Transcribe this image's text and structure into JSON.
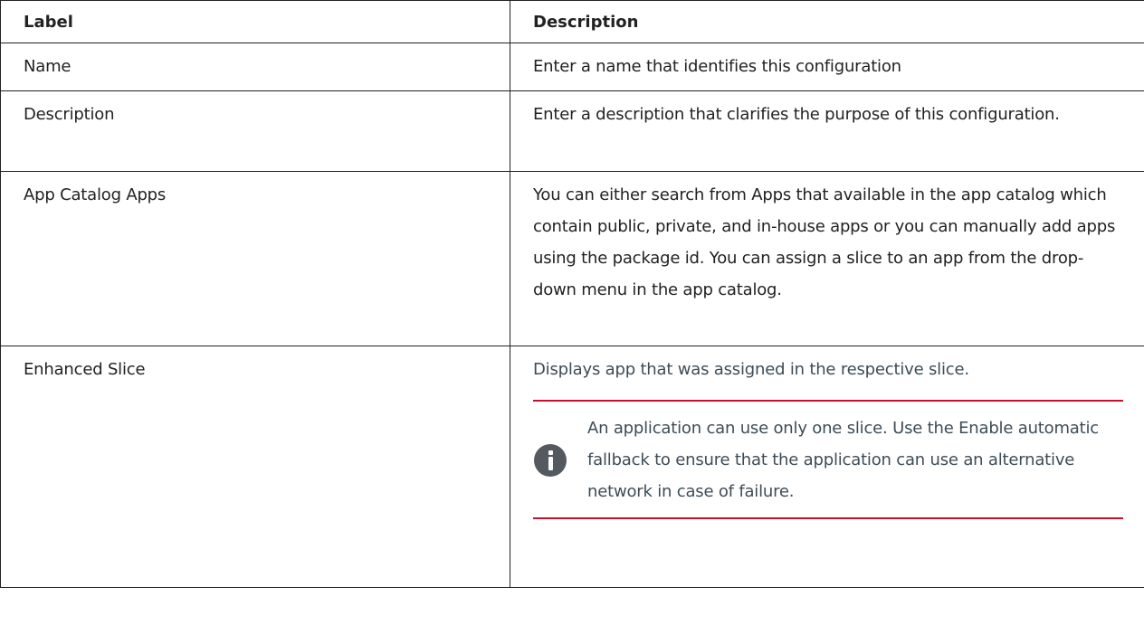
{
  "table": {
    "header": {
      "label": "Label",
      "description": "Description"
    },
    "rows": [
      {
        "label": "Name",
        "description": "Enter a name that identifies this configuration"
      },
      {
        "label": "Description",
        "description": "Enter a description that clarifies the purpose of this configuration."
      },
      {
        "label": "App Catalog Apps",
        "description": "You can either search from Apps that available in the app catalog which contain public, private, and in-house apps or you can manually add apps using the package id. You can assign a slice to an app from the drop-down menu in the app catalog."
      },
      {
        "label": "Enhanced Slice",
        "description": "Displays app that was assigned in the respective slice.",
        "note": {
          "icon": "info-icon",
          "text": "An application can use only one slice. Use the Enable automatic fallback to ensure that the application can use an alternative network in case of failure."
        }
      }
    ]
  },
  "colors": {
    "note_rule": "#c8102e",
    "note_icon_bg": "#555a60",
    "slice_text": "#3d4c57"
  }
}
